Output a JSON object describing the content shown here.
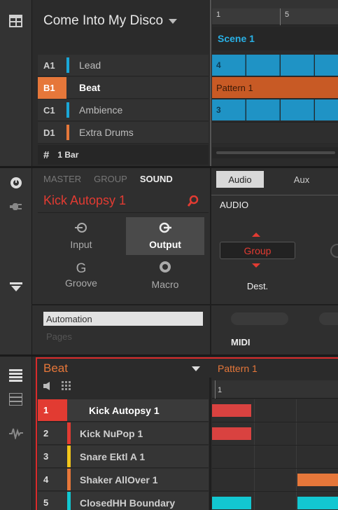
{
  "header": {
    "project_title": "Come Into My Disco",
    "ruler": [
      "1",
      "5"
    ],
    "scene": "Scene 1",
    "groups": [
      {
        "idx": "A1",
        "name": "Lead",
        "color": "#1aa7d8",
        "selected": false
      },
      {
        "idx": "B1",
        "name": "Beat",
        "color": "#e6773a",
        "selected": true
      },
      {
        "idx": "C1",
        "name": "Ambience",
        "color": "#1aa7d8",
        "selected": false
      },
      {
        "idx": "D1",
        "name": "Extra Drums",
        "color": "#e6773a",
        "selected": false
      }
    ],
    "pattern_length_icon": "#",
    "pattern_length": "1 Bar",
    "clips": {
      "a1": "4",
      "b1": "Pattern 1",
      "c1": "3"
    }
  },
  "control": {
    "tabs": [
      "MASTER",
      "GROUP",
      "SOUND"
    ],
    "active_tab": "SOUND",
    "sound_name": "Kick Autopsy 1",
    "pages": [
      {
        "label": "Input",
        "icon": "input-icon"
      },
      {
        "label": "Output",
        "icon": "output-icon",
        "active": true
      },
      {
        "label": "Groove",
        "icon": "groove-icon"
      },
      {
        "label": "Macro",
        "icon": "macro-icon"
      }
    ],
    "param_tabs": [
      "Audio",
      "Aux"
    ],
    "param_section": "AUDIO",
    "dest_value": "Group",
    "dest_label": "Dest.",
    "automation": "Automation",
    "pages_label": "Pages",
    "midi": "MIDI",
    "colors": {
      "accent_red": "#e23b32",
      "cyan": "#1aa7d8",
      "orange": "#e6773a"
    }
  },
  "pattern_editor": {
    "group_name": "Beat",
    "pattern_name": "Pattern 1",
    "ruler_start": "1",
    "sounds": [
      {
        "idx": "1",
        "name": "Kick Autopsy 1",
        "color": "#e23b32",
        "selected": true
      },
      {
        "idx": "2",
        "name": "Kick NuPop 1",
        "color": "#e23b32"
      },
      {
        "idx": "3",
        "name": "Snare Ektl A 1",
        "color": "#f2c51b"
      },
      {
        "idx": "4",
        "name": "Shaker AllOver 1",
        "color": "#e6773a"
      },
      {
        "idx": "5",
        "name": "ClosedHH Boundary",
        "color": "#12c7d1"
      }
    ]
  }
}
